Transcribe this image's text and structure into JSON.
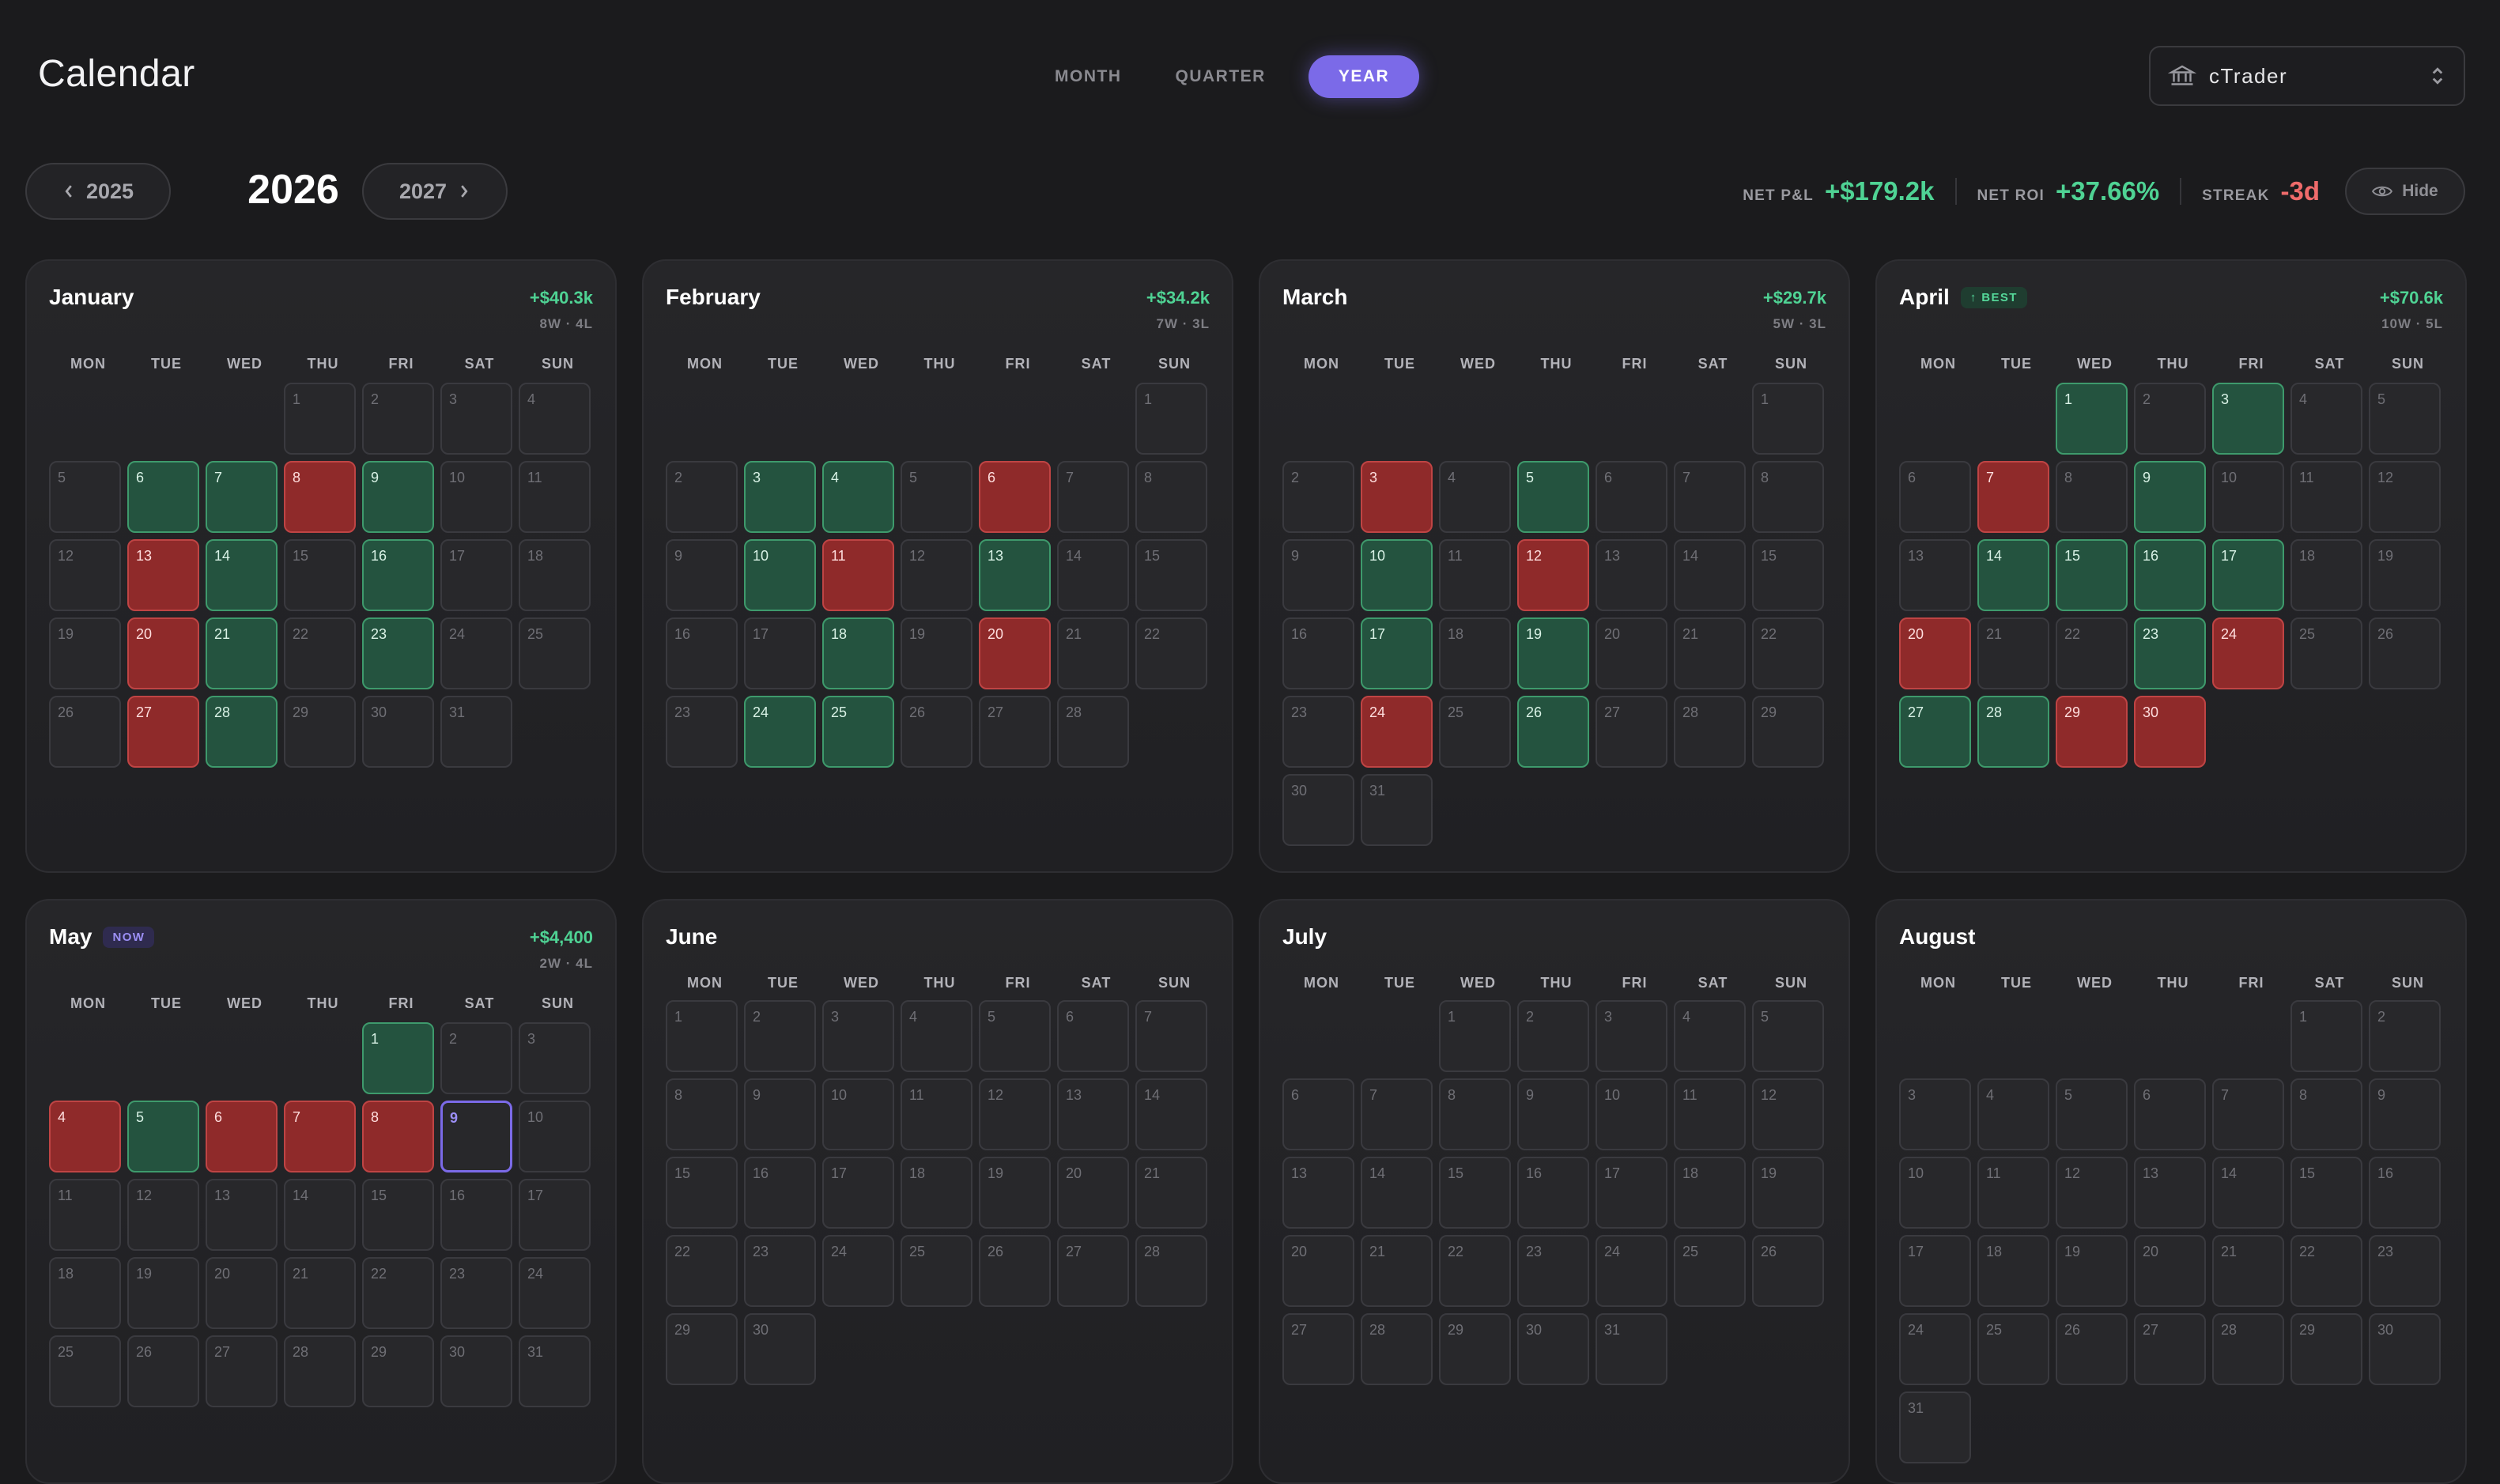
{
  "header": {
    "title": "Calendar",
    "views": [
      {
        "label": "MONTH",
        "active": false
      },
      {
        "label": "QUARTER",
        "active": false
      },
      {
        "label": "YEAR",
        "active": true
      }
    ],
    "account": {
      "label": "cTrader",
      "icon": "bank-icon"
    }
  },
  "year_nav": {
    "prev_label": "2025",
    "current": "2026",
    "next_label": "2027"
  },
  "stats": {
    "net_pnl_label": "NET P&L",
    "net_pnl_value": "+$179.2k",
    "net_roi_label": "NET ROI",
    "net_roi_value": "+37.66%",
    "streak_label": "STREAK",
    "streak_value": "-3d",
    "hide_label": "Hide"
  },
  "colors": {
    "accent": "#7b6ae8",
    "win": "#24533f",
    "loss": "#8f2a2a",
    "positive_text": "#4fd394",
    "negative_text": "#ef6b6b"
  },
  "weekdays": [
    "MON",
    "TUE",
    "WED",
    "THU",
    "FRI",
    "SAT",
    "SUN"
  ],
  "months": [
    {
      "name": "January",
      "badge": "",
      "pnl": "+$40.3k",
      "record": "8W · 4L",
      "first_weekday": 3,
      "days": 31,
      "wins": [
        6,
        7,
        9,
        14,
        16,
        21,
        23,
        28
      ],
      "losses": [
        8,
        13,
        20,
        27
      ],
      "today": 0
    },
    {
      "name": "February",
      "badge": "",
      "pnl": "+$34.2k",
      "record": "7W · 3L",
      "first_weekday": 6,
      "days": 28,
      "wins": [
        3,
        4,
        10,
        13,
        18,
        24,
        25
      ],
      "losses": [
        6,
        11,
        20
      ],
      "today": 0
    },
    {
      "name": "March",
      "badge": "",
      "pnl": "+$29.7k",
      "record": "5W · 3L",
      "first_weekday": 6,
      "days": 31,
      "wins": [
        5,
        10,
        17,
        19,
        26
      ],
      "losses": [
        3,
        12,
        24
      ],
      "today": 0
    },
    {
      "name": "April",
      "badge": "↑ BEST",
      "badge_type": "best",
      "pnl": "+$70.6k",
      "record": "10W · 5L",
      "first_weekday": 2,
      "days": 30,
      "wins": [
        1,
        3,
        9,
        14,
        15,
        16,
        17,
        23,
        27,
        28
      ],
      "losses": [
        7,
        20,
        24,
        29,
        30
      ],
      "today": 0
    },
    {
      "name": "May",
      "badge": "NOW",
      "badge_type": "now",
      "pnl": "+$4,400",
      "record": "2W · 4L",
      "first_weekday": 4,
      "days": 31,
      "wins": [
        1,
        5
      ],
      "losses": [
        4,
        6,
        7,
        8
      ],
      "today": 9
    },
    {
      "name": "June",
      "badge": "",
      "pnl": "",
      "record": "",
      "first_weekday": 0,
      "days": 30,
      "wins": [],
      "losses": [],
      "today": 0
    },
    {
      "name": "July",
      "badge": "",
      "pnl": "",
      "record": "",
      "first_weekday": 2,
      "days": 31,
      "wins": [],
      "losses": [],
      "today": 0
    },
    {
      "name": "August",
      "badge": "",
      "pnl": "",
      "record": "",
      "first_weekday": 5,
      "days": 31,
      "wins": [],
      "losses": [],
      "today": 0
    }
  ]
}
